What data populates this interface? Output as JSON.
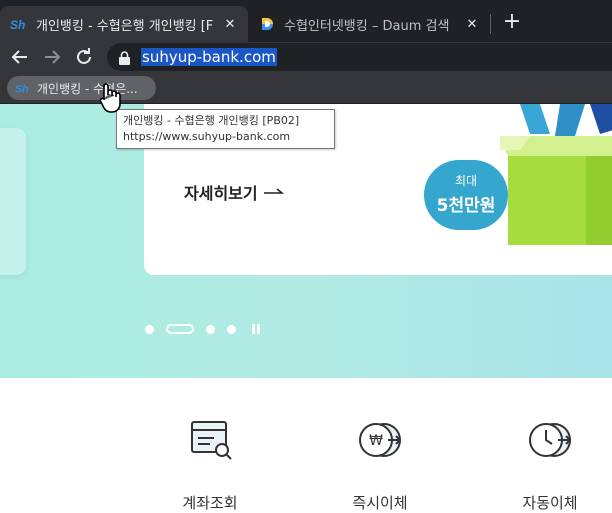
{
  "browser": {
    "tabs": [
      {
        "title": "개인뱅킹 - 수협은행 개인뱅킹 [F",
        "close": "✕",
        "active": true
      },
      {
        "title": "수협인터넷뱅킹 – Daum 검색",
        "close": "✕",
        "active": false
      }
    ],
    "new_tab": "+",
    "url": "suhyup-bank.com",
    "bookmark_label": "개인뱅킹 - 수협은...",
    "tooltip_line1": "개인뱅킹 - 수협은행 개인뱅킹 [PB02]",
    "tooltip_line2": "https://www.suhyup-bank.com"
  },
  "hero": {
    "link_text": "자세히보기",
    "bubble_top": "최대",
    "bubble_main": "5천만원"
  },
  "services": [
    {
      "label": "계좌조회",
      "icon": "account-inquiry-icon"
    },
    {
      "label": "즉시이체",
      "icon": "instant-transfer-icon"
    },
    {
      "label": "자동이체",
      "icon": "auto-transfer-icon"
    }
  ],
  "colors": {
    "tab_bg": "#202124",
    "toolbar_bg": "#35363a",
    "hero_bg": "#a9ece0",
    "bubble": "#35a6ce",
    "gift_green": "#a6dc3e",
    "url_highlight": "#1a56c4"
  }
}
